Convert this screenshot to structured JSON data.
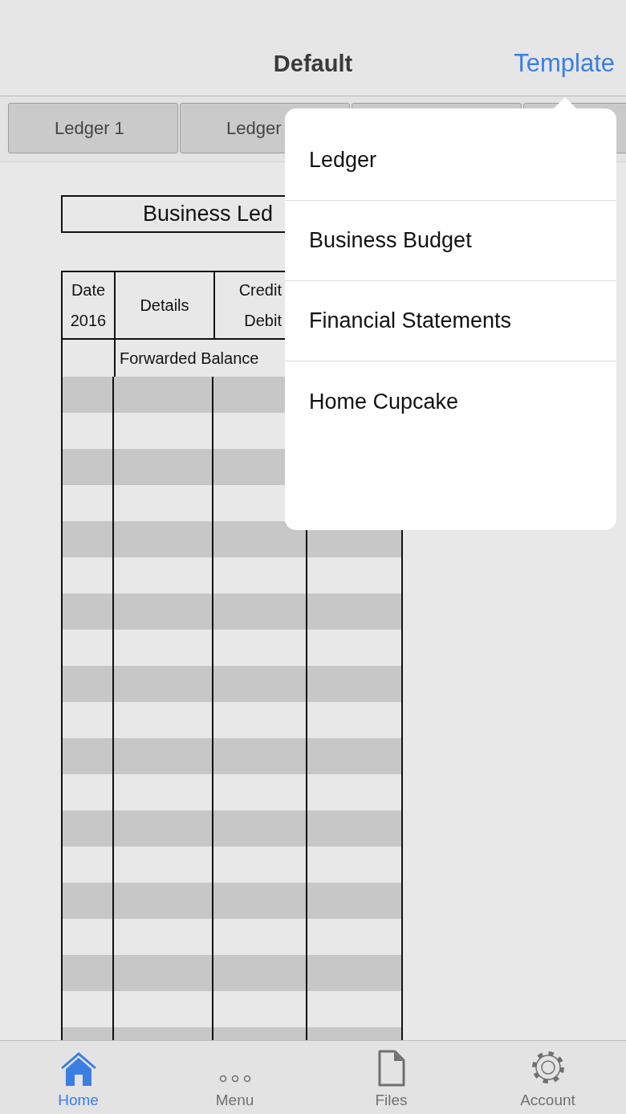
{
  "nav_bar": {
    "title": "Default",
    "action": "Template"
  },
  "tabs": [
    {
      "kind": "labeled",
      "label": "Ledger 1"
    },
    {
      "kind": "labeled",
      "label": "Ledger"
    },
    {
      "kind": "blank"
    },
    {
      "kind": "blank"
    }
  ],
  "ledger": {
    "title": "Business Led",
    "columns": [
      {
        "lines": [
          "Date",
          "2016"
        ]
      },
      {
        "lines": [
          "Details"
        ]
      },
      {
        "lines": [
          "Credit",
          "Debit"
        ]
      }
    ],
    "forwarded": "Forwarded Balance"
  },
  "popover": {
    "items": [
      "Ledger",
      "Business Budget",
      "Financial Statements",
      "Home Cupcake"
    ]
  },
  "tab_bar": [
    {
      "label": "Home",
      "selected": true
    },
    {
      "label": "Menu",
      "selected": false
    },
    {
      "label": "Files",
      "selected": false
    },
    {
      "label": "Account",
      "selected": false
    }
  ]
}
